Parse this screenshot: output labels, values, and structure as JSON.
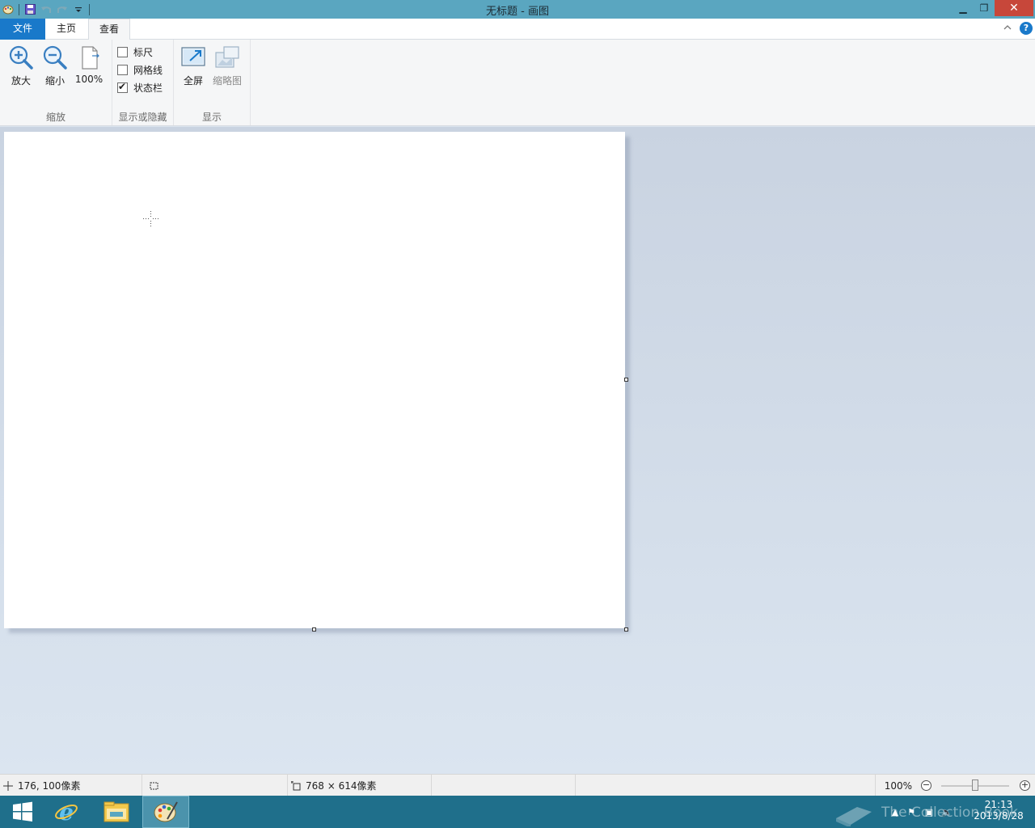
{
  "window": {
    "title": "无标题 - 画图",
    "minimize_symbol": "▁",
    "maximize_symbol": "❐",
    "close_symbol": "✕"
  },
  "qat": {
    "app_icon": "paint-palette-icon",
    "items": [
      "save-icon",
      "undo-icon",
      "redo-icon",
      "customize-dropdown-icon"
    ]
  },
  "tabs": {
    "file": "文件",
    "home": "主页",
    "view": "查看",
    "active": "view"
  },
  "ribbon": {
    "zoom_group": {
      "label": "缩放",
      "zoom_in": "放大",
      "zoom_out": "缩小",
      "actual_size": "100%"
    },
    "show_hide_group": {
      "label": "显示或隐藏",
      "rulers": {
        "label": "标尺",
        "checked": false
      },
      "gridlines": {
        "label": "网格线",
        "checked": false
      },
      "statusbar": {
        "label": "状态栏",
        "checked": true
      }
    },
    "display_group": {
      "label": "显示",
      "fullscreen": "全屏",
      "thumbnail": "缩略图"
    }
  },
  "status": {
    "cursor_position": "176, 100像素",
    "selection_size": "",
    "canvas_size": "768 × 614像素",
    "zoom_level": "100%",
    "zoom_fraction": 0.5
  },
  "taskbar": {
    "items": [
      "windows-start-icon",
      "internet-explorer-icon",
      "file-explorer-icon",
      "paint-icon"
    ],
    "watermark": "The Collection Book",
    "time": "21:13",
    "date": "2013/8/28"
  },
  "colors": {
    "titlebar": "#5aa6c0",
    "file_tab": "#1979ca",
    "taskbar": "#1f6f8b",
    "close_button": "#c7473a"
  }
}
